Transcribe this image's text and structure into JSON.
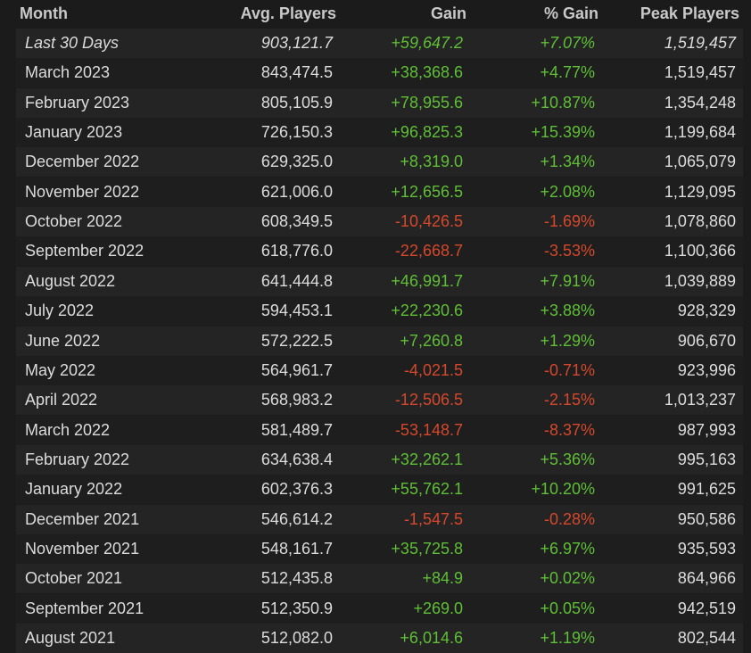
{
  "headers": {
    "month": "Month",
    "avg_players": "Avg. Players",
    "gain": "Gain",
    "pct_gain": "% Gain",
    "peak_players": "Peak Players"
  },
  "colors": {
    "positive": "#5fbf36",
    "negative": "#d5482c"
  },
  "rows": [
    {
      "month": "Last 30 Days",
      "avg": "903,121.7",
      "gain": "+59,647.2",
      "pct": "+7.07%",
      "peak": "1,519,457",
      "sign": "pos",
      "summary": true
    },
    {
      "month": "March 2023",
      "avg": "843,474.5",
      "gain": "+38,368.6",
      "pct": "+4.77%",
      "peak": "1,519,457",
      "sign": "pos"
    },
    {
      "month": "February 2023",
      "avg": "805,105.9",
      "gain": "+78,955.6",
      "pct": "+10.87%",
      "peak": "1,354,248",
      "sign": "pos"
    },
    {
      "month": "January 2023",
      "avg": "726,150.3",
      "gain": "+96,825.3",
      "pct": "+15.39%",
      "peak": "1,199,684",
      "sign": "pos"
    },
    {
      "month": "December 2022",
      "avg": "629,325.0",
      "gain": "+8,319.0",
      "pct": "+1.34%",
      "peak": "1,065,079",
      "sign": "pos"
    },
    {
      "month": "November 2022",
      "avg": "621,006.0",
      "gain": "+12,656.5",
      "pct": "+2.08%",
      "peak": "1,129,095",
      "sign": "pos"
    },
    {
      "month": "October 2022",
      "avg": "608,349.5",
      "gain": "-10,426.5",
      "pct": "-1.69%",
      "peak": "1,078,860",
      "sign": "neg"
    },
    {
      "month": "September 2022",
      "avg": "618,776.0",
      "gain": "-22,668.7",
      "pct": "-3.53%",
      "peak": "1,100,366",
      "sign": "neg"
    },
    {
      "month": "August 2022",
      "avg": "641,444.8",
      "gain": "+46,991.7",
      "pct": "+7.91%",
      "peak": "1,039,889",
      "sign": "pos"
    },
    {
      "month": "July 2022",
      "avg": "594,453.1",
      "gain": "+22,230.6",
      "pct": "+3.88%",
      "peak": "928,329",
      "sign": "pos"
    },
    {
      "month": "June 2022",
      "avg": "572,222.5",
      "gain": "+7,260.8",
      "pct": "+1.29%",
      "peak": "906,670",
      "sign": "pos"
    },
    {
      "month": "May 2022",
      "avg": "564,961.7",
      "gain": "-4,021.5",
      "pct": "-0.71%",
      "peak": "923,996",
      "sign": "neg"
    },
    {
      "month": "April 2022",
      "avg": "568,983.2",
      "gain": "-12,506.5",
      "pct": "-2.15%",
      "peak": "1,013,237",
      "sign": "neg"
    },
    {
      "month": "March 2022",
      "avg": "581,489.7",
      "gain": "-53,148.7",
      "pct": "-8.37%",
      "peak": "987,993",
      "sign": "neg"
    },
    {
      "month": "February 2022",
      "avg": "634,638.4",
      "gain": "+32,262.1",
      "pct": "+5.36%",
      "peak": "995,163",
      "sign": "pos"
    },
    {
      "month": "January 2022",
      "avg": "602,376.3",
      "gain": "+55,762.1",
      "pct": "+10.20%",
      "peak": "991,625",
      "sign": "pos"
    },
    {
      "month": "December 2021",
      "avg": "546,614.2",
      "gain": "-1,547.5",
      "pct": "-0.28%",
      "peak": "950,586",
      "sign": "neg"
    },
    {
      "month": "November 2021",
      "avg": "548,161.7",
      "gain": "+35,725.8",
      "pct": "+6.97%",
      "peak": "935,593",
      "sign": "pos"
    },
    {
      "month": "October 2021",
      "avg": "512,435.8",
      "gain": "+84.9",
      "pct": "+0.02%",
      "peak": "864,966",
      "sign": "pos"
    },
    {
      "month": "September 2021",
      "avg": "512,350.9",
      "gain": "+269.0",
      "pct": "+0.05%",
      "peak": "942,519",
      "sign": "pos"
    },
    {
      "month": "August 2021",
      "avg": "512,082.0",
      "gain": "+6,014.6",
      "pct": "+1.19%",
      "peak": "802,544",
      "sign": "pos"
    }
  ]
}
